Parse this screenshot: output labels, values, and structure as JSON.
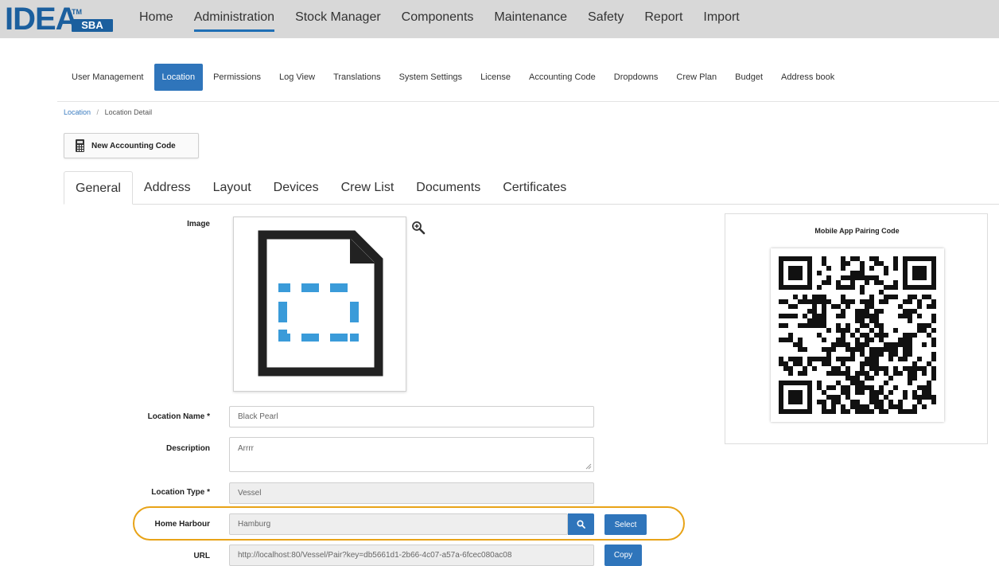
{
  "brand": {
    "name": "IDEA",
    "tm": "TM",
    "suffix": "SBA",
    "color": "#1b5f9e"
  },
  "topnav": [
    {
      "label": "Home",
      "active": false
    },
    {
      "label": "Administration",
      "active": true
    },
    {
      "label": "Stock Manager",
      "active": false
    },
    {
      "label": "Components",
      "active": false
    },
    {
      "label": "Maintenance",
      "active": false
    },
    {
      "label": "Safety",
      "active": false
    },
    {
      "label": "Report",
      "active": false
    },
    {
      "label": "Import",
      "active": false
    }
  ],
  "subnav": [
    {
      "label": "User Management",
      "active": false
    },
    {
      "label": "Location",
      "active": true
    },
    {
      "label": "Permissions",
      "active": false
    },
    {
      "label": "Log View",
      "active": false
    },
    {
      "label": "Translations",
      "active": false
    },
    {
      "label": "System Settings",
      "active": false
    },
    {
      "label": "License",
      "active": false
    },
    {
      "label": "Accounting Code",
      "active": false
    },
    {
      "label": "Dropdowns",
      "active": false
    },
    {
      "label": "Crew Plan",
      "active": false
    },
    {
      "label": "Budget",
      "active": false
    },
    {
      "label": "Address book",
      "active": false
    }
  ],
  "breadcrumb": {
    "parent": "Location",
    "separator": "/",
    "current": "Location Detail"
  },
  "toolbar": {
    "new_accounting_code": "New Accounting Code",
    "icon": "calculator-icon"
  },
  "tabs": [
    {
      "label": "General",
      "active": true
    },
    {
      "label": "Address",
      "active": false
    },
    {
      "label": "Layout",
      "active": false
    },
    {
      "label": "Devices",
      "active": false
    },
    {
      "label": "Crew List",
      "active": false
    },
    {
      "label": "Documents",
      "active": false
    },
    {
      "label": "Certificates",
      "active": false
    }
  ],
  "form": {
    "image_label": "Image",
    "image_icon": "image-placeholder-icon",
    "zoom_icon": "zoom-in-icon",
    "location_name_label": "Location Name *",
    "location_name_value": "Black Pearl",
    "description_label": "Description",
    "description_value": "Arrrr",
    "location_type_label": "Location Type *",
    "location_type_value": "Vessel",
    "home_harbour_label": "Home Harbour",
    "home_harbour_value": "Hamburg",
    "search_icon": "search-icon",
    "select_label": "Select",
    "url_label": "URL",
    "url_value": "http://localhost:80/Vessel/Pair?key=db5661d1-2b66-4c07-a57a-6fcec080ac08",
    "copy_label": "Copy"
  },
  "pairing": {
    "title": "Mobile App Pairing Code",
    "icon": "qr-code-icon"
  },
  "colors": {
    "accent": "#2f75bb",
    "highlight": "#e8a317",
    "topbar": "#d8d8d8",
    "image_blue": "#3a9bd9"
  }
}
